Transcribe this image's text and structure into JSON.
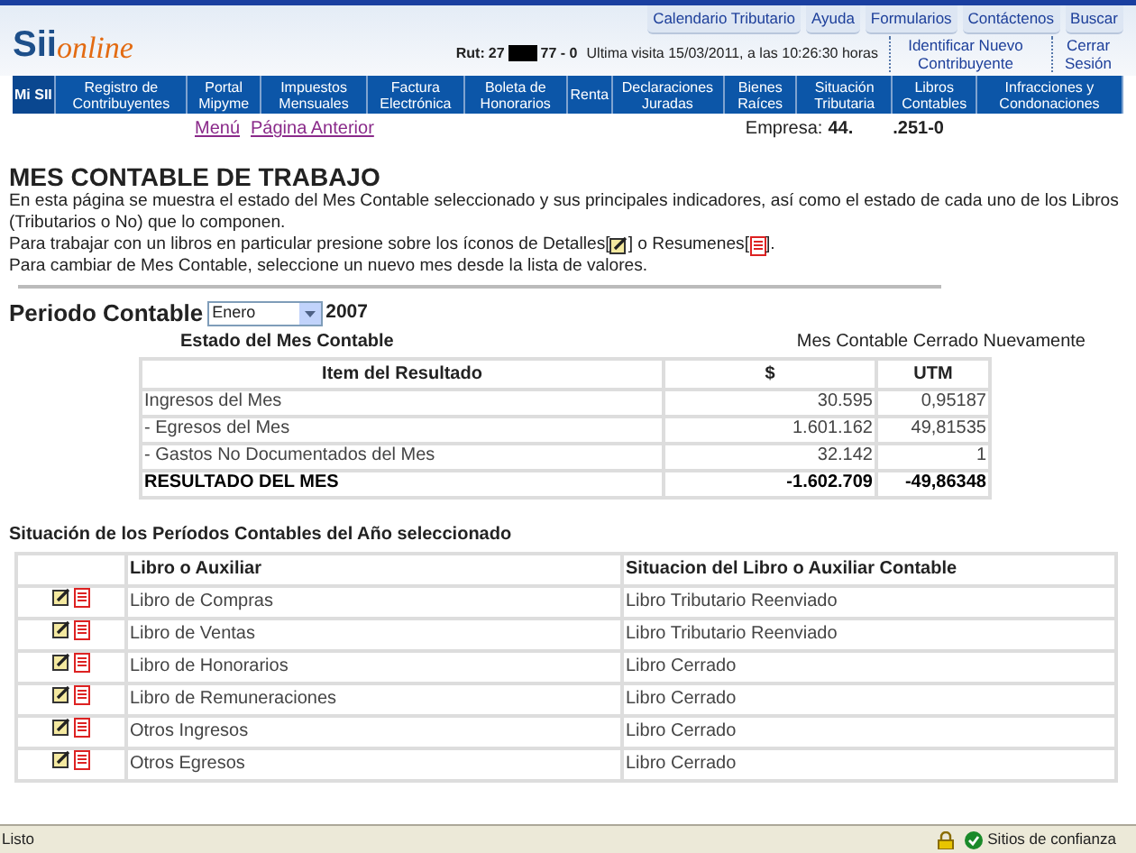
{
  "logo": {
    "brand_a": "Sii",
    "brand_b": "online"
  },
  "top_links": [
    "Calendario Tributario",
    "Ayuda",
    "Formularios",
    "Contáctenos",
    "Buscar"
  ],
  "user_info": {
    "rut_label": "Rut:",
    "rut_prefix": "27",
    "rut_suffix": "77 - 0",
    "last_visit": "Ultima visita 15/03/2011, a las 10:26:30 horas"
  },
  "account_links": [
    "Identificar Nuevo Contribuyente",
    "Cerrar Sesión"
  ],
  "nav": [
    {
      "label": "Mi SII",
      "selected": true
    },
    {
      "label": "Registro de Contribuyentes",
      "selected": false
    },
    {
      "label": "Portal Mipyme",
      "selected": false
    },
    {
      "label": "Impuestos Mensuales",
      "selected": false
    },
    {
      "label": "Factura Electrónica",
      "selected": false
    },
    {
      "label": "Boleta de Honorarios",
      "selected": false
    },
    {
      "label": "Renta",
      "selected": false
    },
    {
      "label": "Declaraciones Juradas",
      "selected": false
    },
    {
      "label": "Bienes Raíces",
      "selected": false
    },
    {
      "label": "Situación Tributaria",
      "selected": false
    },
    {
      "label": "Libros Contables",
      "selected": false
    },
    {
      "label": "Infracciones y Condonaciones",
      "selected": false
    }
  ],
  "page_links": [
    "Menú",
    "Página Anterior"
  ],
  "company": {
    "label": "Empresa:",
    "value_a": "44.",
    "value_b": ".251-0"
  },
  "title": "MES CONTABLE DE TRABAJO",
  "intro": [
    "En esta página se muestra el estado del Mes Contable seleccionado y sus principales indicadores, así como el estado de cada uno de los Libros (Tributarios o No) que lo componen.",
    "Para trabajar con un libros en particular presione sobre los íconos de Detalles[",
    "] o Resumenes[",
    "].",
    "Para cambiar de Mes Contable, seleccione un nuevo mes desde la lista de valores."
  ],
  "period": {
    "label": "Periodo Contable",
    "month": "Enero",
    "year": "2007"
  },
  "month_status": {
    "label": "Estado del Mes Contable",
    "value": "Mes Contable Cerrado Nuevamente"
  },
  "result_table": {
    "columns": [
      "Item del Resultado",
      "$",
      "UTM"
    ],
    "rows": [
      {
        "kind": "item",
        "cells": [
          "Ingresos del Mes",
          "30.595",
          "0,95187"
        ]
      },
      {
        "kind": "item",
        "cells": [
          "- Egresos del Mes",
          "1.601.162",
          "49,81535"
        ]
      },
      {
        "kind": "item",
        "cells": [
          "- Gastos No Documentados del Mes",
          "32.142",
          "1"
        ]
      },
      {
        "kind": "total",
        "cells": [
          "RESULTADO DEL MES",
          "-1.602.709",
          "-49,86348"
        ]
      }
    ]
  },
  "books_section": {
    "title": "Situación de los Períodos Contables del Año seleccionado",
    "columns": [
      "Libro o Auxiliar",
      "Situacion del Libro o Auxiliar Contable"
    ],
    "rows": [
      [
        "Libro de Compras",
        "Libro Tributario Reenviado"
      ],
      [
        "Libro de Ventas",
        "Libro Tributario Reenviado"
      ],
      [
        "Libro de Honorarios",
        "Libro Cerrado"
      ],
      [
        "Libro de Remuneraciones",
        "Libro Cerrado"
      ],
      [
        "Otros Ingresos",
        "Libro Cerrado"
      ],
      [
        "Otros Egresos",
        "Libro Cerrado"
      ]
    ]
  },
  "status_bar": {
    "text": "Listo",
    "zone": "Sitios de confianza"
  }
}
